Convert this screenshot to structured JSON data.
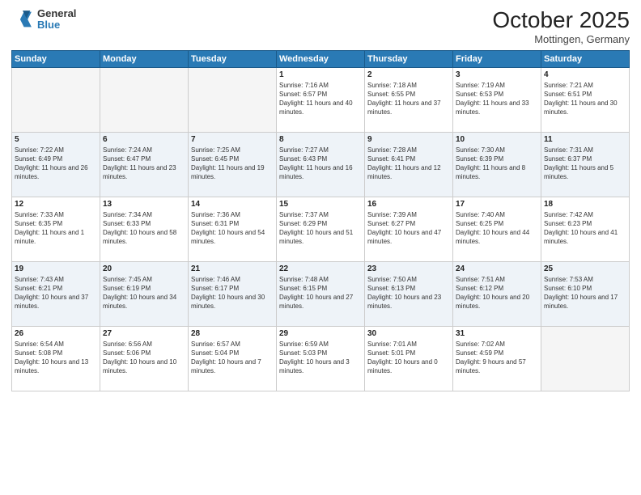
{
  "logo": {
    "general": "General",
    "blue": "Blue"
  },
  "header": {
    "month": "October 2025",
    "location": "Mottingen, Germany"
  },
  "weekdays": [
    "Sunday",
    "Monday",
    "Tuesday",
    "Wednesday",
    "Thursday",
    "Friday",
    "Saturday"
  ],
  "weeks": [
    [
      {
        "day": "",
        "empty": true
      },
      {
        "day": "",
        "empty": true
      },
      {
        "day": "",
        "empty": true
      },
      {
        "day": "1",
        "sunrise": "Sunrise: 7:16 AM",
        "sunset": "Sunset: 6:57 PM",
        "daylight": "Daylight: 11 hours and 40 minutes."
      },
      {
        "day": "2",
        "sunrise": "Sunrise: 7:18 AM",
        "sunset": "Sunset: 6:55 PM",
        "daylight": "Daylight: 11 hours and 37 minutes."
      },
      {
        "day": "3",
        "sunrise": "Sunrise: 7:19 AM",
        "sunset": "Sunset: 6:53 PM",
        "daylight": "Daylight: 11 hours and 33 minutes."
      },
      {
        "day": "4",
        "sunrise": "Sunrise: 7:21 AM",
        "sunset": "Sunset: 6:51 PM",
        "daylight": "Daylight: 11 hours and 30 minutes."
      }
    ],
    [
      {
        "day": "5",
        "sunrise": "Sunrise: 7:22 AM",
        "sunset": "Sunset: 6:49 PM",
        "daylight": "Daylight: 11 hours and 26 minutes."
      },
      {
        "day": "6",
        "sunrise": "Sunrise: 7:24 AM",
        "sunset": "Sunset: 6:47 PM",
        "daylight": "Daylight: 11 hours and 23 minutes."
      },
      {
        "day": "7",
        "sunrise": "Sunrise: 7:25 AM",
        "sunset": "Sunset: 6:45 PM",
        "daylight": "Daylight: 11 hours and 19 minutes."
      },
      {
        "day": "8",
        "sunrise": "Sunrise: 7:27 AM",
        "sunset": "Sunset: 6:43 PM",
        "daylight": "Daylight: 11 hours and 16 minutes."
      },
      {
        "day": "9",
        "sunrise": "Sunrise: 7:28 AM",
        "sunset": "Sunset: 6:41 PM",
        "daylight": "Daylight: 11 hours and 12 minutes."
      },
      {
        "day": "10",
        "sunrise": "Sunrise: 7:30 AM",
        "sunset": "Sunset: 6:39 PM",
        "daylight": "Daylight: 11 hours and 8 minutes."
      },
      {
        "day": "11",
        "sunrise": "Sunrise: 7:31 AM",
        "sunset": "Sunset: 6:37 PM",
        "daylight": "Daylight: 11 hours and 5 minutes."
      }
    ],
    [
      {
        "day": "12",
        "sunrise": "Sunrise: 7:33 AM",
        "sunset": "Sunset: 6:35 PM",
        "daylight": "Daylight: 11 hours and 1 minute."
      },
      {
        "day": "13",
        "sunrise": "Sunrise: 7:34 AM",
        "sunset": "Sunset: 6:33 PM",
        "daylight": "Daylight: 10 hours and 58 minutes."
      },
      {
        "day": "14",
        "sunrise": "Sunrise: 7:36 AM",
        "sunset": "Sunset: 6:31 PM",
        "daylight": "Daylight: 10 hours and 54 minutes."
      },
      {
        "day": "15",
        "sunrise": "Sunrise: 7:37 AM",
        "sunset": "Sunset: 6:29 PM",
        "daylight": "Daylight: 10 hours and 51 minutes."
      },
      {
        "day": "16",
        "sunrise": "Sunrise: 7:39 AM",
        "sunset": "Sunset: 6:27 PM",
        "daylight": "Daylight: 10 hours and 47 minutes."
      },
      {
        "day": "17",
        "sunrise": "Sunrise: 7:40 AM",
        "sunset": "Sunset: 6:25 PM",
        "daylight": "Daylight: 10 hours and 44 minutes."
      },
      {
        "day": "18",
        "sunrise": "Sunrise: 7:42 AM",
        "sunset": "Sunset: 6:23 PM",
        "daylight": "Daylight: 10 hours and 41 minutes."
      }
    ],
    [
      {
        "day": "19",
        "sunrise": "Sunrise: 7:43 AM",
        "sunset": "Sunset: 6:21 PM",
        "daylight": "Daylight: 10 hours and 37 minutes."
      },
      {
        "day": "20",
        "sunrise": "Sunrise: 7:45 AM",
        "sunset": "Sunset: 6:19 PM",
        "daylight": "Daylight: 10 hours and 34 minutes."
      },
      {
        "day": "21",
        "sunrise": "Sunrise: 7:46 AM",
        "sunset": "Sunset: 6:17 PM",
        "daylight": "Daylight: 10 hours and 30 minutes."
      },
      {
        "day": "22",
        "sunrise": "Sunrise: 7:48 AM",
        "sunset": "Sunset: 6:15 PM",
        "daylight": "Daylight: 10 hours and 27 minutes."
      },
      {
        "day": "23",
        "sunrise": "Sunrise: 7:50 AM",
        "sunset": "Sunset: 6:13 PM",
        "daylight": "Daylight: 10 hours and 23 minutes."
      },
      {
        "day": "24",
        "sunrise": "Sunrise: 7:51 AM",
        "sunset": "Sunset: 6:12 PM",
        "daylight": "Daylight: 10 hours and 20 minutes."
      },
      {
        "day": "25",
        "sunrise": "Sunrise: 7:53 AM",
        "sunset": "Sunset: 6:10 PM",
        "daylight": "Daylight: 10 hours and 17 minutes."
      }
    ],
    [
      {
        "day": "26",
        "sunrise": "Sunrise: 6:54 AM",
        "sunset": "Sunset: 5:08 PM",
        "daylight": "Daylight: 10 hours and 13 minutes."
      },
      {
        "day": "27",
        "sunrise": "Sunrise: 6:56 AM",
        "sunset": "Sunset: 5:06 PM",
        "daylight": "Daylight: 10 hours and 10 minutes."
      },
      {
        "day": "28",
        "sunrise": "Sunrise: 6:57 AM",
        "sunset": "Sunset: 5:04 PM",
        "daylight": "Daylight: 10 hours and 7 minutes."
      },
      {
        "day": "29",
        "sunrise": "Sunrise: 6:59 AM",
        "sunset": "Sunset: 5:03 PM",
        "daylight": "Daylight: 10 hours and 3 minutes."
      },
      {
        "day": "30",
        "sunrise": "Sunrise: 7:01 AM",
        "sunset": "Sunset: 5:01 PM",
        "daylight": "Daylight: 10 hours and 0 minutes."
      },
      {
        "day": "31",
        "sunrise": "Sunrise: 7:02 AM",
        "sunset": "Sunset: 4:59 PM",
        "daylight": "Daylight: 9 hours and 57 minutes."
      },
      {
        "day": "",
        "empty": true
      }
    ]
  ]
}
